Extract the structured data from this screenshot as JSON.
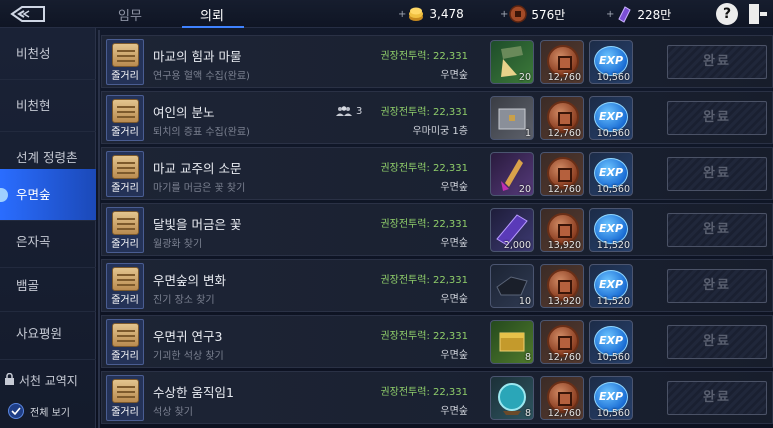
{
  "tabs": [
    {
      "label": "임무"
    },
    {
      "label": "의뢰"
    }
  ],
  "currencies": [
    {
      "icon": "gold-coins-icon",
      "value": "3,478"
    },
    {
      "icon": "copper-coin-icon",
      "value": "576만"
    },
    {
      "icon": "crystal-icon",
      "value": "228만"
    }
  ],
  "help_label": "?",
  "sidebar": {
    "items": [
      {
        "label": "비천성"
      },
      {
        "label": "비천현"
      },
      {
        "label": "선계 정령촌"
      },
      {
        "label": "우면숲"
      },
      {
        "label": "은자곡"
      },
      {
        "label": "뱀골"
      },
      {
        "label": "사요평원"
      }
    ],
    "locked_label": "서천 교역지",
    "show_all_label": "전체 보기"
  },
  "quests": [
    {
      "category": "줄거리",
      "title": "마교의 힘과 마물",
      "subtitle": "연구용 혈액 수집(완료)",
      "party": "",
      "power": "권장전투력: 22,331",
      "location": "우면숲",
      "rewards": [
        {
          "type": "item",
          "icon": "potion-jar-icon",
          "count": "20"
        },
        {
          "type": "coin",
          "icon": "copper-coin-icon",
          "count": "12,760"
        },
        {
          "type": "exp",
          "icon": "exp-icon",
          "label": "EXP",
          "count": "10,560"
        }
      ],
      "done_label": "완료"
    },
    {
      "category": "줄거리",
      "title": "여인의 분노",
      "subtitle": "퇴치의 증표 수집(완료)",
      "party": "3",
      "power": "권장전투력: 22,331",
      "location": "우마미궁 1층",
      "rewards": [
        {
          "type": "item",
          "icon": "chest-icon",
          "count": "1"
        },
        {
          "type": "coin",
          "icon": "copper-coin-icon",
          "count": "12,760"
        },
        {
          "type": "exp",
          "icon": "exp-icon",
          "label": "EXP",
          "count": "10,560"
        }
      ],
      "done_label": "완료"
    },
    {
      "category": "줄거리",
      "title": "마교 교주의 소문",
      "subtitle": "마기를 머금은 꽃 찾기",
      "party": "",
      "power": "권장전투력: 22,331",
      "location": "우면숲",
      "rewards": [
        {
          "type": "item",
          "icon": "dagger-gem-icon",
          "count": "20"
        },
        {
          "type": "coin",
          "icon": "copper-coin-icon",
          "count": "12,760"
        },
        {
          "type": "exp",
          "icon": "exp-icon",
          "label": "EXP",
          "count": "10,560"
        }
      ],
      "done_label": "완료"
    },
    {
      "category": "줄거리",
      "title": "달빛을 머금은 꽃",
      "subtitle": "월광화 찾기",
      "party": "",
      "power": "권장전투력: 22,331",
      "location": "우면숲",
      "rewards": [
        {
          "type": "item",
          "icon": "crystal-icon",
          "count": "2,000"
        },
        {
          "type": "coin",
          "icon": "copper-coin-icon",
          "count": "13,920"
        },
        {
          "type": "exp",
          "icon": "exp-icon",
          "label": "EXP",
          "count": "11,520"
        }
      ],
      "done_label": "완료"
    },
    {
      "category": "줄거리",
      "title": "우면숲의 변화",
      "subtitle": "진기 장소 찾기",
      "party": "",
      "power": "권장전투력: 22,331",
      "location": "우면숲",
      "rewards": [
        {
          "type": "item",
          "icon": "ore-icon",
          "count": "10"
        },
        {
          "type": "coin",
          "icon": "copper-coin-icon",
          "count": "13,920"
        },
        {
          "type": "exp",
          "icon": "exp-icon",
          "label": "EXP",
          "count": "11,520"
        }
      ],
      "done_label": "완료"
    },
    {
      "category": "줄거리",
      "title": "우면귀 연구3",
      "subtitle": "기괴한 석상 찾기",
      "party": "",
      "power": "권장전투력: 22,331",
      "location": "우면숲",
      "rewards": [
        {
          "type": "item",
          "icon": "gold-box-icon",
          "count": "8"
        },
        {
          "type": "coin",
          "icon": "copper-coin-icon",
          "count": "12,760"
        },
        {
          "type": "exp",
          "icon": "exp-icon",
          "label": "EXP",
          "count": "10,560"
        }
      ],
      "done_label": "완료"
    },
    {
      "category": "줄거리",
      "title": "수상한 움직임1",
      "subtitle": "석상 찾기",
      "party": "",
      "power": "권장전투력: 22,331",
      "location": "우면숲",
      "rewards": [
        {
          "type": "item",
          "icon": "orb-icon",
          "count": "8"
        },
        {
          "type": "coin",
          "icon": "copper-coin-icon",
          "count": "12,760"
        },
        {
          "type": "exp",
          "icon": "exp-icon",
          "label": "EXP",
          "count": "10,560"
        }
      ],
      "done_label": "완료"
    }
  ],
  "colors": {
    "accent": "#2a6dff",
    "power_text": "#8fce6a",
    "background": "#0d1220"
  }
}
